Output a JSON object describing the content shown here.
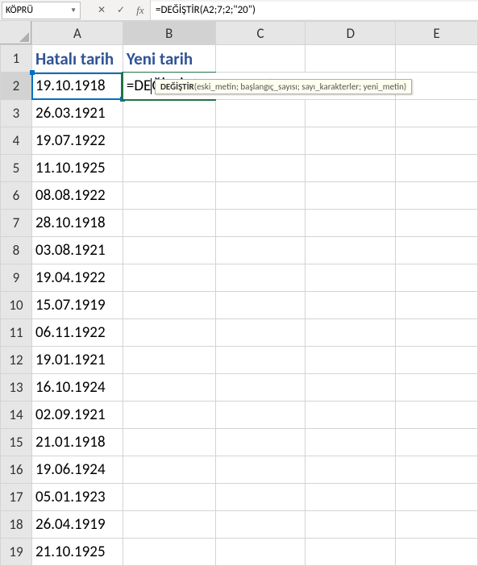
{
  "chart_data": {
    "type": "table",
    "columns": [
      "Hatalı tarih",
      "Yeni tarih"
    ],
    "rows": [
      [
        "19.10.1918",
        "=DEĞİŞTİR(A2;7;2;\"20\")"
      ],
      [
        "26.03.1921",
        ""
      ],
      [
        "19.07.1922",
        ""
      ],
      [
        "11.10.1925",
        ""
      ],
      [
        "08.08.1922",
        ""
      ],
      [
        "28.10.1918",
        ""
      ],
      [
        "03.08.1921",
        ""
      ],
      [
        "19.04.1922",
        ""
      ],
      [
        "15.07.1919",
        ""
      ],
      [
        "06.11.1922",
        ""
      ],
      [
        "19.01.1921",
        ""
      ],
      [
        "16.10.1924",
        ""
      ],
      [
        "02.09.1921",
        ""
      ],
      [
        "21.01.1918",
        ""
      ],
      [
        "19.06.1924",
        ""
      ],
      [
        "05.01.1923",
        ""
      ],
      [
        "26.04.1919",
        ""
      ],
      [
        "21.10.1925",
        ""
      ]
    ]
  },
  "nameBox": "KÖPRÜ",
  "formulaBar": "=DEĞİŞTİR(A2;7;2;\"20\")",
  "columns": [
    "A",
    "B",
    "C",
    "D",
    "E"
  ],
  "headers": {
    "A": "Hatalı tarih",
    "B": "Yeni tarih"
  },
  "editing": {
    "part1": "=DE",
    "part2": "ĞİŞTİR(",
    "ref": "A2",
    "part3": ";7;2;",
    "str": "\"20\"",
    "part4": ")"
  },
  "tooltip": {
    "fn": "DEĞİŞTİR",
    "sig": "(eski_metin; başlangıç_sayısı; sayı_karakterler; yeni_metin)"
  },
  "rows": [
    {
      "n": "1",
      "a": "",
      "b": ""
    },
    {
      "n": "2",
      "a": "19.10.1918",
      "b": ""
    },
    {
      "n": "3",
      "a": "26.03.1921",
      "b": ""
    },
    {
      "n": "4",
      "a": "19.07.1922",
      "b": ""
    },
    {
      "n": "5",
      "a": "11.10.1925",
      "b": ""
    },
    {
      "n": "6",
      "a": "08.08.1922",
      "b": ""
    },
    {
      "n": "7",
      "a": "28.10.1918",
      "b": ""
    },
    {
      "n": "8",
      "a": "03.08.1921",
      "b": ""
    },
    {
      "n": "9",
      "a": "19.04.1922",
      "b": ""
    },
    {
      "n": "10",
      "a": "15.07.1919",
      "b": ""
    },
    {
      "n": "11",
      "a": "06.11.1922",
      "b": ""
    },
    {
      "n": "12",
      "a": "19.01.1921",
      "b": ""
    },
    {
      "n": "13",
      "a": "16.10.1924",
      "b": ""
    },
    {
      "n": "14",
      "a": "02.09.1921",
      "b": ""
    },
    {
      "n": "15",
      "a": "21.01.1918",
      "b": ""
    },
    {
      "n": "16",
      "a": "19.06.1924",
      "b": ""
    },
    {
      "n": "17",
      "a": "05.01.1923",
      "b": ""
    },
    {
      "n": "18",
      "a": "26.04.1919",
      "b": ""
    },
    {
      "n": "19",
      "a": "21.10.1925",
      "b": ""
    }
  ]
}
